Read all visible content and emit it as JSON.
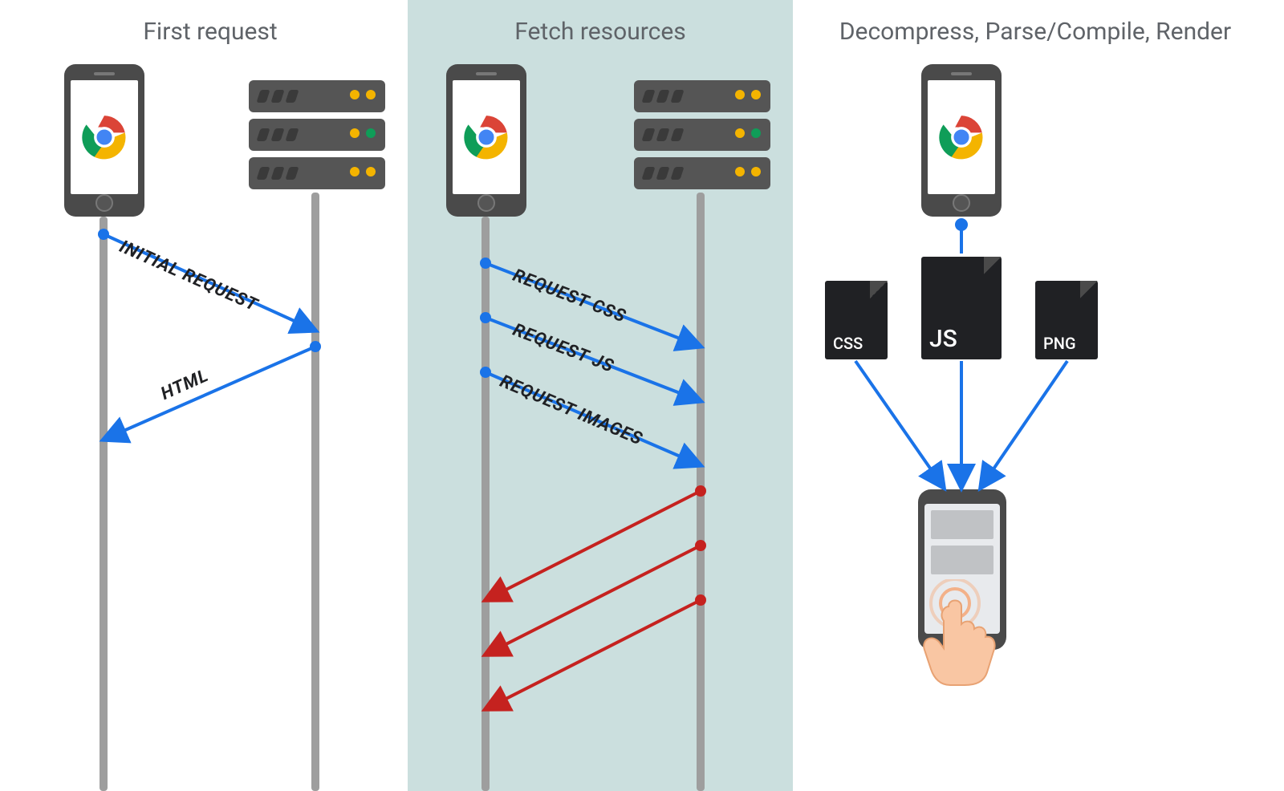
{
  "panels": {
    "first_request": {
      "title": "First request"
    },
    "fetch_resources": {
      "title": "Fetch resources"
    },
    "render": {
      "title": "Decompress, Parse/Compile, Render"
    }
  },
  "arrow_labels": {
    "initial_request": "INITIAL REQUEST",
    "html": "HTML",
    "request_css": "REQUEST CSS",
    "request_js": "REQUEST JS",
    "request_images": "REQUEST IMAGES"
  },
  "files": {
    "css": "CSS",
    "js": "JS",
    "png": "PNG"
  },
  "colors": {
    "blue": "#1a73e8",
    "red": "#c5221f",
    "panel_bg": "#cbdfde",
    "grey_text": "#5f6368",
    "file_bg": "#202124"
  }
}
